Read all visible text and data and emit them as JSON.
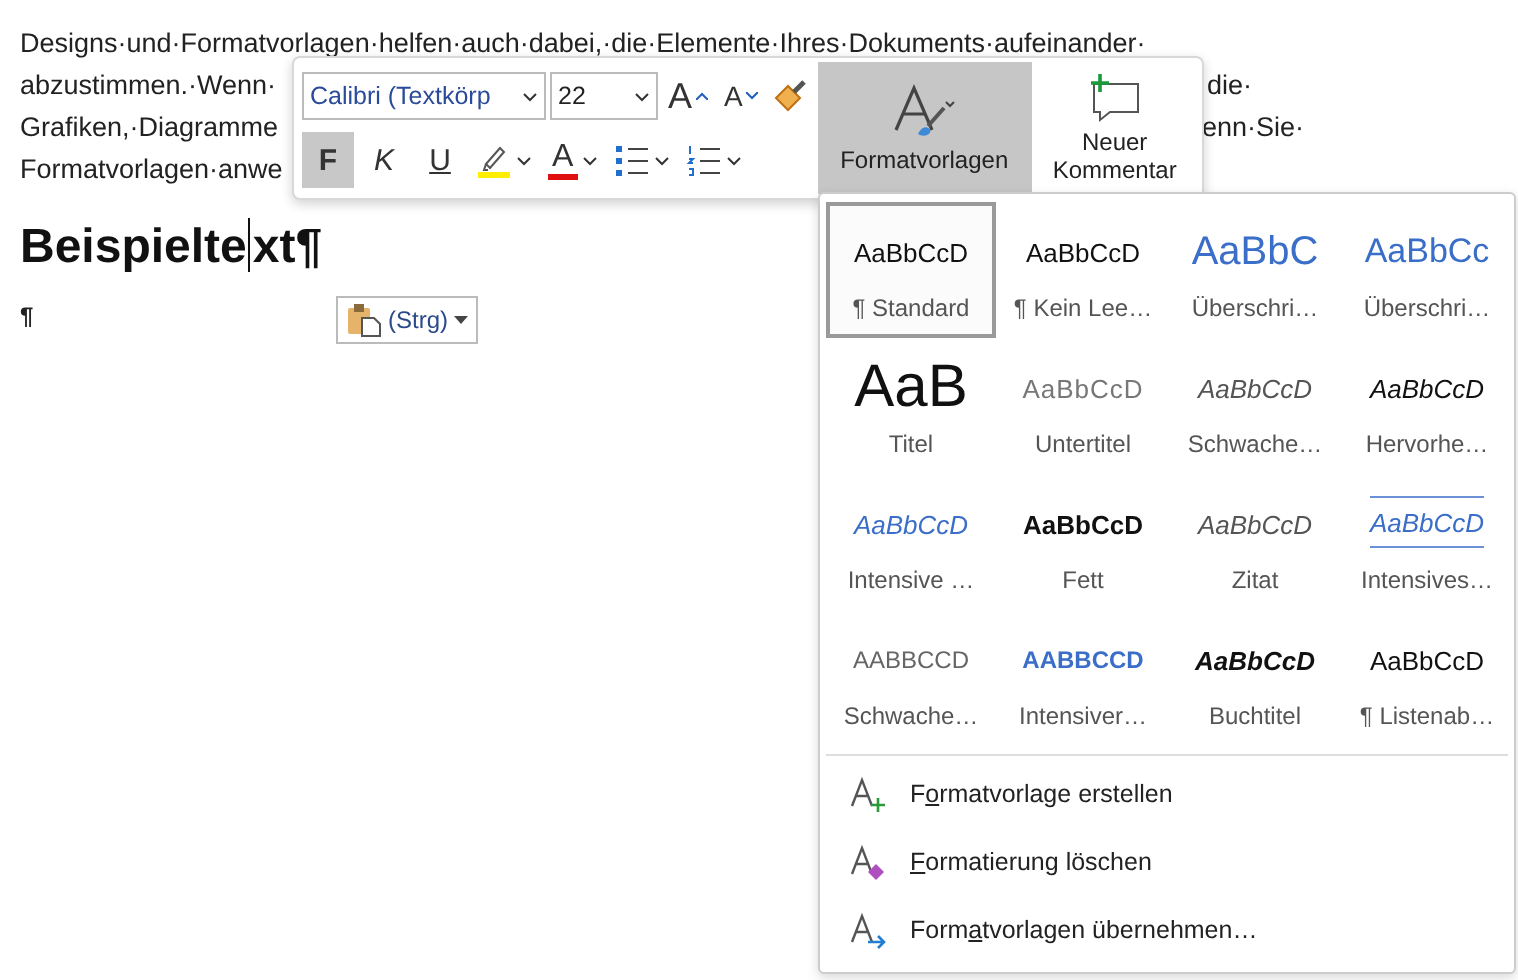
{
  "document": {
    "lines": [
      {
        "left": "Designs·und·Formatvorlagen·helfen·auch·dabei,·die·Elemente·Ihres·Dokuments·aufeinander·"
      },
      {
        "left": "abzustimmen.·Wenn·",
        "right": "die·"
      },
      {
        "left": "Grafiken,·Diagramme",
        "right": "enn·Sie·"
      },
      {
        "left": "Formatvorlagen·anwe"
      }
    ],
    "heading": {
      "before_cursor": "Beispielte",
      "after_cursor": "xt¶"
    },
    "empty_paragraph": "¶",
    "paste_button": {
      "label": "(Strg)"
    }
  },
  "mini_toolbar": {
    "font": "Calibri (Textkörp",
    "size": "22",
    "grow": "A",
    "shrink": "A",
    "format": [
      {
        "kind": "bold",
        "label": "F",
        "selected": true
      },
      {
        "kind": "italic",
        "label": "K",
        "selected": false
      },
      {
        "kind": "underline",
        "label": "U",
        "selected": false
      },
      {
        "kind": "highlight",
        "selected": false
      },
      {
        "kind": "font-color",
        "label": "A",
        "selected": false
      },
      {
        "kind": "bullets",
        "selected": false
      },
      {
        "kind": "numbering",
        "selected": false
      }
    ],
    "styles_button": {
      "label": "Formatvorlagen",
      "selected": true
    },
    "comment_button": {
      "label": "Neuer Kommentar"
    }
  },
  "styles_gallery": {
    "styles": [
      {
        "kind": "plain",
        "preview": "AaBbCcD",
        "label": "¶ Standard",
        "selected": true
      },
      {
        "kind": "plain",
        "preview": "AaBbCcD",
        "label": "¶ Kein Lee…",
        "selected": false
      },
      {
        "kind": "heading1",
        "preview": "AaBbC",
        "label": "Überschri…",
        "selected": false
      },
      {
        "kind": "heading2",
        "preview": "AaBbCc",
        "label": "Überschri…",
        "selected": false
      },
      {
        "kind": "title",
        "preview": "AaB",
        "label": "Titel",
        "selected": false
      },
      {
        "kind": "subtitle",
        "preview": "AaBbCcD",
        "label": "Untertitel",
        "selected": false
      },
      {
        "kind": "subtle",
        "preview": "AaBbCcD",
        "label": "Schwache…",
        "selected": false
      },
      {
        "kind": "emphasis",
        "preview": "AaBbCcD",
        "label": "Hervorhe…",
        "selected": false
      },
      {
        "kind": "intense",
        "preview": "AaBbCcD",
        "label": "Intensive …",
        "selected": false
      },
      {
        "kind": "strong",
        "preview": "AaBbCcD",
        "label": "Fett",
        "selected": false
      },
      {
        "kind": "quote",
        "preview": "AaBbCcD",
        "label": "Zitat",
        "selected": false
      },
      {
        "kind": "intense-quote",
        "preview": "AaBbCcD",
        "label": "Intensives…",
        "selected": false
      },
      {
        "kind": "subtle-ref",
        "preview": "AABBCCD",
        "label": "Schwache…",
        "selected": false
      },
      {
        "kind": "intense-ref",
        "preview": "AABBCCD",
        "label": "Intensiver…",
        "selected": false
      },
      {
        "kind": "book-title",
        "preview": "AaBbCcD",
        "label": "Buchtitel",
        "selected": false
      },
      {
        "kind": "plain",
        "preview": "AaBbCcD",
        "label": "¶ Listenab…",
        "selected": false
      }
    ],
    "commands": [
      {
        "kind": "create",
        "before": "F",
        "key": "o",
        "after": "rmatvorlage erstellen"
      },
      {
        "kind": "clear",
        "key": "F",
        "after": "ormatierung löschen"
      },
      {
        "kind": "apply",
        "before": "Form",
        "key": "a",
        "after": "tvorlagen übernehmen…"
      }
    ]
  }
}
